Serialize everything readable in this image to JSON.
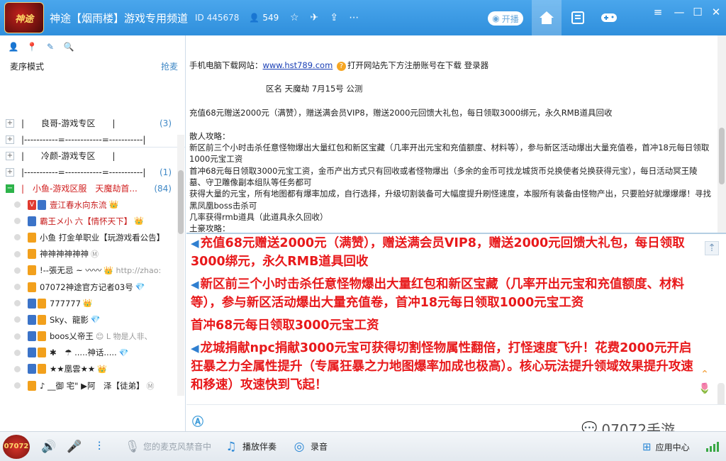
{
  "header": {
    "logo_text": "神途",
    "title": "神途【烟雨楼】游戏专用频道",
    "channel_id": "ID 445678",
    "user_count": "549",
    "stream_button": "开播",
    "accent": "#2f8fdc"
  },
  "left": {
    "mic_mode": "麦序模式",
    "grab_mic": "抢麦",
    "channels": [
      {
        "name": "|　　良哥-游戏专区　　|",
        "count": "(3)",
        "expanded": false
      },
      {
        "name": "|-----------=------------=-----------|",
        "count": "",
        "expanded": false
      },
      {
        "name": "|　　冷颜-游戏专区　　|",
        "count": "",
        "expanded": false
      },
      {
        "name": "|-----------=------------=-----------|",
        "count": "(1)",
        "expanded": false
      },
      {
        "name": "|　小鱼-游戏区服　天魔劫首...",
        "count": "(84)",
        "expanded": true
      }
    ],
    "users": [
      {
        "name": "壹江春水向东流",
        "red": true,
        "badges": [
          "V",
          "b"
        ],
        "deco": "👑"
      },
      {
        "name": "霸王メ小 六【情怀天下】",
        "red": true,
        "badges": [
          "b"
        ],
        "deco": "👑"
      },
      {
        "name": "小鱼 打金单职业【玩游戏看公告】",
        "red": false,
        "badges": [
          "o"
        ],
        "deco": ""
      },
      {
        "name": "神神神神神神",
        "red": false,
        "badges": [
          "o"
        ],
        "deco": "Ⓜ"
      },
      {
        "name": "!--張无忌 ~ 〰〰",
        "red": false,
        "badges": [
          "o"
        ],
        "deco": "👑 http://zhao:"
      },
      {
        "name": "07072神途官方记者03号",
        "red": false,
        "badges": [
          "o"
        ],
        "deco": "💎"
      },
      {
        "name": "777777",
        "red": false,
        "badges": [
          "b",
          "o"
        ],
        "deco": "👑"
      },
      {
        "name": "Sky、龍影",
        "red": false,
        "badges": [
          "b",
          "o"
        ],
        "deco": "💎"
      },
      {
        "name": "boos乂帝王",
        "red": false,
        "badges": [
          "b",
          "o"
        ],
        "deco": "😊 L 物是人非、"
      },
      {
        "name": "✱　☂ .....神话.....",
        "red": false,
        "badges": [
          "b",
          "o"
        ],
        "deco": "💎"
      },
      {
        "name": "★★凰雲★★",
        "red": false,
        "badges": [
          "b",
          "o"
        ],
        "deco": "👑"
      },
      {
        "name": "♪ __御 宅\" ▶阿　泽【徒弟】",
        "red": false,
        "badges": [
          "o"
        ],
        "deco": "Ⓜ"
      }
    ]
  },
  "announcement": {
    "download_label": "手机电脑下载网站：",
    "download_url": "www.hst789.com",
    "download_note": "打开网站先下方注册账号在下载 登录器",
    "server_line": "区名 天魔劫 7月15号 公测",
    "recharge_line": "充值68元赠送2000元（满赞），赠送满会员VIP8，赠送2000元回馈大礼包，每日领取3000绑元，永久RMB道具回收",
    "guide_title": "散人攻略：",
    "guide_1": "新区前三个小时击杀任意怪物爆出大量红包和新区宝藏（几率开出元宝和充值额度、材料等），参与新区活动爆出大量充值卷，首冲18元每日领取1000元宝工资",
    "guide_2": "首冲68元每日领取3000元宝工资，金币产出方式只有回收或者怪物爆出（多余的金币可找龙城货币兑换使者兑换获得元宝），每日活动冥王陵墓、守卫雕像副本组队等任务都可",
    "guide_3": "获得大量的元宝，所有地图都有爆率加成，自行选择，升级切割装备可大幅度提升刷怪速度，本服所有装备由怪物产出，只要脸好就爆爆爆！寻找黑凤凰boss击杀可",
    "guide_4": "几率获得rmb道具（此道具永久回收）",
    "guide_5": "土豪攻略："
  },
  "chat": {
    "messages": [
      {
        "speaker": true,
        "text": "充值68元赠送2000元（满赞），赠送满会员VIP8，赠送2000元回馈大礼包，每日领取3000绑元，永久RMB道具回收"
      },
      {
        "speaker": true,
        "text": "新区前三个小时击杀任意怪物爆出大量红包和新区宝藏（几率开出元宝和充值额度、材料等），参与新区活动爆出大量充值卷，首冲18元每日领取1000元宝工资"
      },
      {
        "speaker": false,
        "text": "首冲68元每日领取3000元宝工资"
      },
      {
        "speaker": true,
        "text": "龙城捐献npc捐献3000元宝可获得切割怪物属性翻倍，打怪速度飞升！花费2000元开启狂暴之力全属性提升（专属狂暴之力地图爆率加成也极高）。核心玩法提升领域效果提升攻速和移速）攻速快到飞起！"
      }
    ],
    "message_color": "#e8191b"
  },
  "bottom": {
    "logo_text": "07072",
    "mic_banned": "您的麦克风禁音中",
    "play_music": "播放伴奏",
    "record": "录音",
    "app_center": "应用中心"
  },
  "watermark": "07072手游"
}
